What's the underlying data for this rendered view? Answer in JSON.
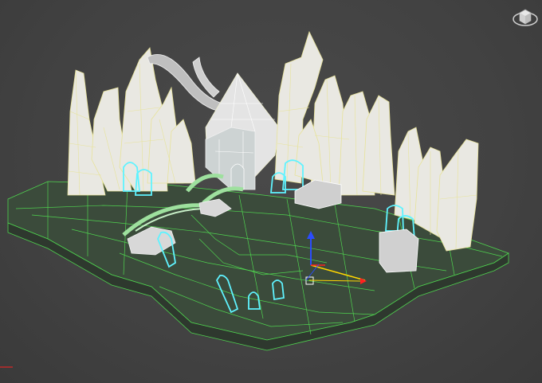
{
  "viewport": {
    "label": "",
    "background": "#444444"
  },
  "colors": {
    "ground_wire": "#4fd34f",
    "rock_wire": "#e8e39a",
    "selection_outline": "#5ff3ff",
    "gizmo_x": "#ff2020",
    "gizmo_y": "#ffd600",
    "gizmo_z": "#2b4cff"
  },
  "icons": {
    "viewcube": "viewcube-icon",
    "transform_gizmo": "move-gizmo-icon"
  }
}
